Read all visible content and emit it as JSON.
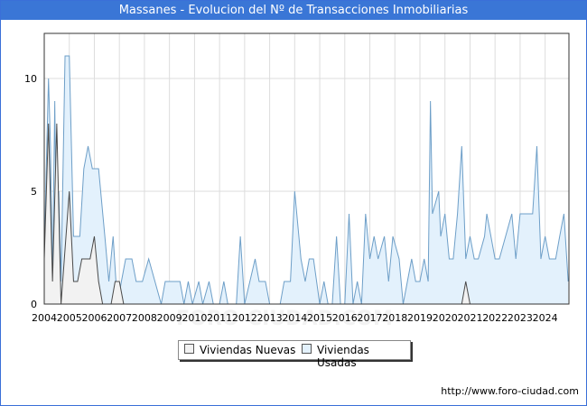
{
  "title": "Massanes - Evolucion del Nº de Transacciones Inmobiliarias",
  "url": "http://www.foro-ciudad.com",
  "watermark": "FORO-CIUDAD.COM",
  "legend": {
    "nuevas": "Viviendas Nuevas",
    "usadas": "Viviendas Usadas"
  },
  "colors": {
    "title_bg": "#3a76d6",
    "usadas_fill": "#e3f1fc",
    "usadas_line": "#6e9fc8",
    "nuevas_fill": "#f2f2f2",
    "nuevas_line": "#4a4a4a",
    "grid": "#dddddd"
  },
  "chart_data": {
    "type": "area",
    "title": "Massanes - Evolucion del Nº de Transacciones Inmobiliarias",
    "x_tick_labels": [
      "2004",
      "2005",
      "2006",
      "2007",
      "2008",
      "2009",
      "2010",
      "2011",
      "2012",
      "2013",
      "2014",
      "2015",
      "2016",
      "2017",
      "2018",
      "2019",
      "2020",
      "2021",
      "2022",
      "2023",
      "2024"
    ],
    "y_ticks": [
      0,
      5,
      10
    ],
    "ylim": [
      0,
      12
    ],
    "x_range": [
      2004,
      2024.95
    ],
    "grid": true,
    "legend_position": "bottom-center",
    "series": [
      {
        "name": "Viviendas Usadas",
        "points": [
          [
            2004.0,
            2
          ],
          [
            2004.08,
            6
          ],
          [
            2004.17,
            10
          ],
          [
            2004.25,
            7
          ],
          [
            2004.33,
            1
          ],
          [
            2004.42,
            9
          ],
          [
            2004.5,
            1
          ],
          [
            2004.58,
            5
          ],
          [
            2004.67,
            1
          ],
          [
            2004.83,
            11
          ],
          [
            2005.0,
            11
          ],
          [
            2005.17,
            3
          ],
          [
            2005.42,
            3
          ],
          [
            2005.58,
            6
          ],
          [
            2005.75,
            7
          ],
          [
            2005.92,
            6
          ],
          [
            2006.17,
            6
          ],
          [
            2006.42,
            3
          ],
          [
            2006.58,
            1
          ],
          [
            2006.75,
            3
          ],
          [
            2006.92,
            0
          ],
          [
            2007.08,
            1
          ],
          [
            2007.25,
            2
          ],
          [
            2007.5,
            2
          ],
          [
            2007.67,
            1
          ],
          [
            2007.92,
            1
          ],
          [
            2008.17,
            2
          ],
          [
            2008.42,
            1
          ],
          [
            2008.67,
            0
          ],
          [
            2008.83,
            1
          ],
          [
            2009.0,
            1
          ],
          [
            2009.42,
            1
          ],
          [
            2009.58,
            0
          ],
          [
            2009.75,
            1
          ],
          [
            2009.92,
            0
          ],
          [
            2010.17,
            1
          ],
          [
            2010.33,
            0
          ],
          [
            2010.58,
            1
          ],
          [
            2010.75,
            0
          ],
          [
            2011.0,
            0
          ],
          [
            2011.17,
            1
          ],
          [
            2011.33,
            0
          ],
          [
            2011.67,
            0
          ],
          [
            2011.83,
            3
          ],
          [
            2012.0,
            0
          ],
          [
            2012.42,
            2
          ],
          [
            2012.58,
            1
          ],
          [
            2012.83,
            1
          ],
          [
            2013.0,
            0
          ],
          [
            2013.42,
            0
          ],
          [
            2013.58,
            1
          ],
          [
            2013.83,
            1
          ],
          [
            2014.0,
            5
          ],
          [
            2014.25,
            2
          ],
          [
            2014.42,
            1
          ],
          [
            2014.58,
            2
          ],
          [
            2014.75,
            2
          ],
          [
            2015.0,
            0
          ],
          [
            2015.17,
            1
          ],
          [
            2015.33,
            0
          ],
          [
            2015.5,
            0
          ],
          [
            2015.67,
            3
          ],
          [
            2015.83,
            0
          ],
          [
            2016.0,
            0
          ],
          [
            2016.17,
            4
          ],
          [
            2016.33,
            0
          ],
          [
            2016.5,
            1
          ],
          [
            2016.67,
            0
          ],
          [
            2016.83,
            4
          ],
          [
            2017.0,
            2
          ],
          [
            2017.17,
            3
          ],
          [
            2017.33,
            2
          ],
          [
            2017.58,
            3
          ],
          [
            2017.75,
            1
          ],
          [
            2017.92,
            3
          ],
          [
            2018.17,
            2
          ],
          [
            2018.33,
            0
          ],
          [
            2018.5,
            1
          ],
          [
            2018.67,
            2
          ],
          [
            2018.83,
            1
          ],
          [
            2019.0,
            1
          ],
          [
            2019.17,
            2
          ],
          [
            2019.33,
            1
          ],
          [
            2019.42,
            9
          ],
          [
            2019.5,
            4
          ],
          [
            2019.75,
            5
          ],
          [
            2019.83,
            3
          ],
          [
            2020.0,
            4
          ],
          [
            2020.17,
            2
          ],
          [
            2020.33,
            2
          ],
          [
            2020.5,
            4
          ],
          [
            2020.67,
            7
          ],
          [
            2020.83,
            2
          ],
          [
            2021.0,
            3
          ],
          [
            2021.17,
            2
          ],
          [
            2021.33,
            2
          ],
          [
            2021.58,
            3
          ],
          [
            2021.67,
            4
          ],
          [
            2022.0,
            2
          ],
          [
            2022.17,
            2
          ],
          [
            2022.42,
            3
          ],
          [
            2022.67,
            4
          ],
          [
            2022.83,
            2
          ],
          [
            2023.0,
            4
          ],
          [
            2023.17,
            4
          ],
          [
            2023.5,
            4
          ],
          [
            2023.67,
            7
          ],
          [
            2023.83,
            2
          ],
          [
            2024.0,
            3
          ],
          [
            2024.17,
            2
          ],
          [
            2024.42,
            2
          ],
          [
            2024.58,
            3
          ],
          [
            2024.75,
            4
          ],
          [
            2024.92,
            1
          ]
        ]
      },
      {
        "name": "Viviendas Nuevas",
        "points": [
          [
            2004.0,
            2
          ],
          [
            2004.17,
            8
          ],
          [
            2004.33,
            1
          ],
          [
            2004.5,
            8
          ],
          [
            2004.67,
            0
          ],
          [
            2005.0,
            5
          ],
          [
            2005.17,
            1
          ],
          [
            2005.33,
            1
          ],
          [
            2005.5,
            2
          ],
          [
            2005.83,
            2
          ],
          [
            2006.0,
            3
          ],
          [
            2006.17,
            1
          ],
          [
            2006.33,
            0
          ],
          [
            2006.67,
            0
          ],
          [
            2006.83,
            1
          ],
          [
            2007.0,
            1
          ],
          [
            2007.17,
            0
          ],
          [
            2020.67,
            0
          ],
          [
            2020.83,
            1
          ],
          [
            2021.0,
            0
          ],
          [
            2024.92,
            0
          ]
        ]
      }
    ]
  }
}
